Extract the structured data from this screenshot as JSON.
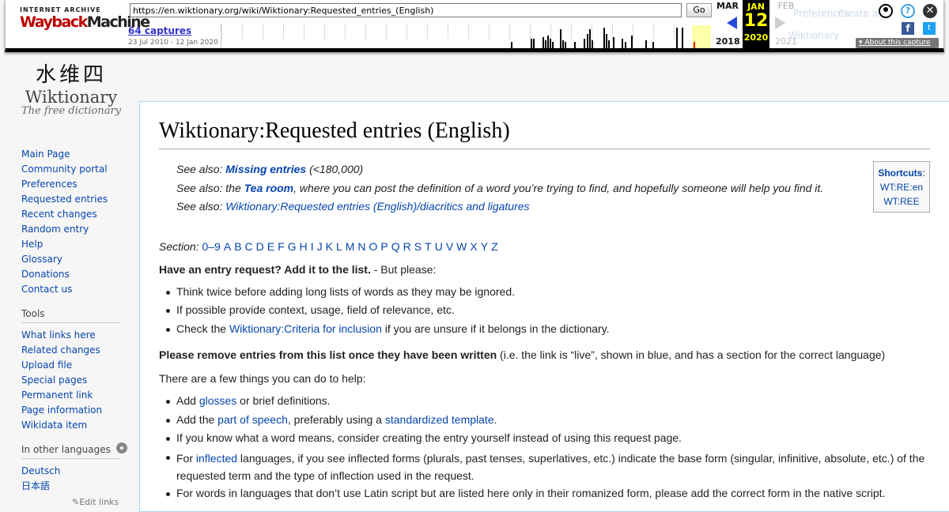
{
  "wayback": {
    "logo_top": "INTERNET ARCHIVE",
    "logo_main_a": "Wayback",
    "logo_main_b": "Machine",
    "url": "https://en.wiktionary.org/wiki/Wiktionary:Requested_entries_(English)",
    "go_label": "Go",
    "captures": "64 captures",
    "date_range": "23 Jul 2010 - 12 Jan 2020",
    "prev_month": "MAR",
    "cur_month": "JAN",
    "next_month": "FEB",
    "cur_day": "12",
    "prev_year": "2018",
    "cur_year": "2020",
    "next_year": "2021",
    "about_label": "About this capture",
    "help_glyph": "?",
    "close_glyph": "✕",
    "fb_glyph": "f",
    "tw_glyph": "t",
    "ghost_prefs": "Preferences",
    "ghost_create": "Create a",
    "ghost_wiktionary": "Wiktionary",
    "icons": [
      "user-icon",
      "help-icon",
      "close-icon",
      "facebook-icon",
      "twitter-icon",
      "prev-arrow-icon",
      "next-arrow-icon"
    ]
  },
  "logo": {
    "chars": "水维四",
    "title": "Wiktionary",
    "tagline": "The free dictionary"
  },
  "sidebar": {
    "nav": [
      "Main Page",
      "Community portal",
      "Preferences",
      "Requested entries",
      "Recent changes",
      "Random entry",
      "Help",
      "Glossary",
      "Donations",
      "Contact us"
    ],
    "tools_heading": "Tools",
    "tools": [
      "What links here",
      "Related changes",
      "Upload file",
      "Special pages",
      "Permanent link",
      "Page information",
      "Wikidata item"
    ],
    "languages_heading": "In other languages",
    "languages": [
      "Deutsch",
      "日本語"
    ],
    "edit_links": "Edit links"
  },
  "page": {
    "title": "Wiktionary:Requested entries (English)",
    "seealso1_prefix": "See also: ",
    "seealso1_link": "Missing entries",
    "seealso1_suffix": " (<180,000)",
    "seealso2_prefix": "See also: the ",
    "seealso2_link": "Tea room",
    "seealso2_suffix": ", where you can post the definition of a word you’re trying to find, and hopefully someone will help you find it.",
    "seealso3_prefix": "See also: ",
    "seealso3_link": "Wiktionary:Requested entries (English)/diacritics and ligatures",
    "shortcuts_label": "Shortcuts",
    "shortcuts_colon": ":",
    "shortcut1": "WT:RE:en",
    "shortcut2": "WT:REE",
    "section_label": "Section: ",
    "section_letters": [
      "0–9",
      "A",
      "B",
      "C",
      "D",
      "E",
      "F",
      "G",
      "H",
      "I",
      "J",
      "K",
      "L",
      "M",
      "N",
      "O",
      "P",
      "Q",
      "R",
      "S",
      "T",
      "U",
      "V",
      "W",
      "X",
      "Y",
      "Z"
    ],
    "request_bold": "Have an entry request? Add it to the list.",
    "request_rest": " - But please:",
    "bullet1": "Think twice before adding long lists of words as they may be ignored.",
    "bullet2": "If possible provide context, usage, field of relevance, etc.",
    "bullet3_a": "Check the ",
    "bullet3_link": "Wiktionary:Criteria for inclusion",
    "bullet3_b": " if you are unsure if it belongs in the dictionary.",
    "remove_bold": "Please remove entries from this list once they have been written",
    "remove_rest": " (i.e. the link is “live”, shown in blue, and has a section for the correct language)",
    "help_intro": "There are a few things you can do to help:",
    "help1_a": "Add ",
    "help1_link": "glosses",
    "help1_b": " or brief definitions.",
    "help2_a": "Add the ",
    "help2_link1": "part of speech",
    "help2_b": ", preferably using a ",
    "help2_link2": "standardized template",
    "help2_c": ".",
    "help3": "If you know what a word means, consider creating the entry yourself instead of using this request page.",
    "help4_a": "For ",
    "help4_link": "inflected",
    "help4_b": " languages, if you see inflected forms (plurals, past tenses, superlatives, etc.) indicate the base form (singular, infinitive, absolute, etc.) of the requested term and the type of inflection used in the request.",
    "help5": "For words in languages that don’t use Latin script but are listed here only in their romanized form, please add the correct form in the native script."
  }
}
